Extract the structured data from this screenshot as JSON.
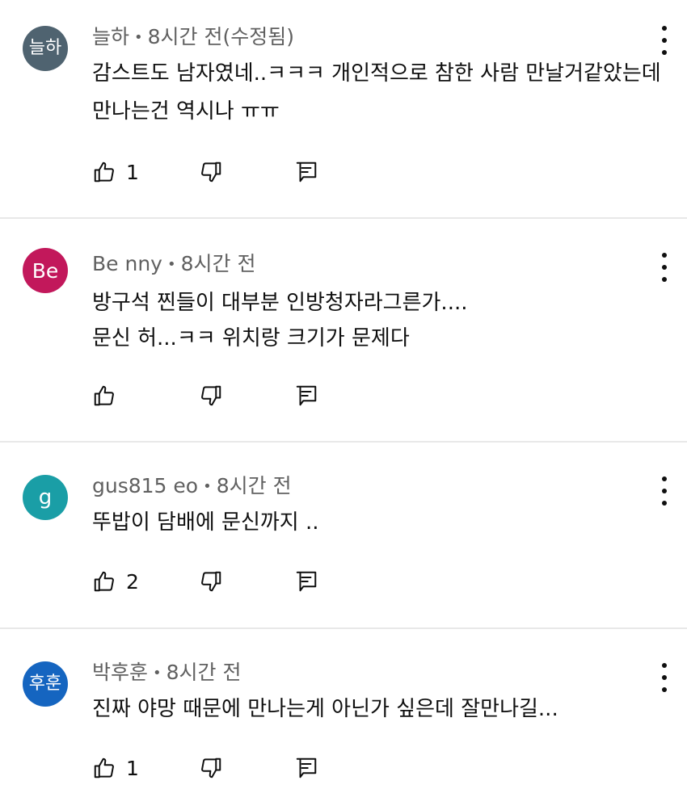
{
  "comments": [
    {
      "avatar_text": "늘하",
      "avatar_color": "#4f6370",
      "author": "늘하",
      "time": "8시간 전(수정됨)",
      "lines": [
        "감스트도 남자였네..ㅋㅋㅋ 개인적으로 참한 사람 만날거같았는데",
        "만나는건 역시나 ㅠㅠ"
      ],
      "likes": "1"
    },
    {
      "avatar_text": "Be",
      "avatar_color": "#c2185b",
      "author": "Be nny",
      "time": "8시간 전",
      "lines": [
        "방구석 찐들이 대부분 인방청자라그른가....",
        "문신 허...ㅋㅋ 위치랑 크기가 문제다"
      ],
      "likes": ""
    },
    {
      "avatar_text": "g",
      "avatar_color": "#1a9ea6",
      "author": "gus815 eo",
      "time": "8시간 전",
      "lines": [
        "뚜밥이 담배에 문신까지 .."
      ],
      "likes": "2"
    },
    {
      "avatar_text": "후훈",
      "avatar_color": "#1565c0",
      "author": "박후훈",
      "time": "8시간 전",
      "lines": [
        "진짜 야망 때문에 만나는게 아닌가 싶은데 잘만나길..."
      ],
      "likes": "1"
    }
  ],
  "separator": "•",
  "icons": {
    "like": "thumbs-up-icon",
    "dislike": "thumbs-down-icon",
    "reply": "reply-icon",
    "more": "more-vert-icon"
  }
}
